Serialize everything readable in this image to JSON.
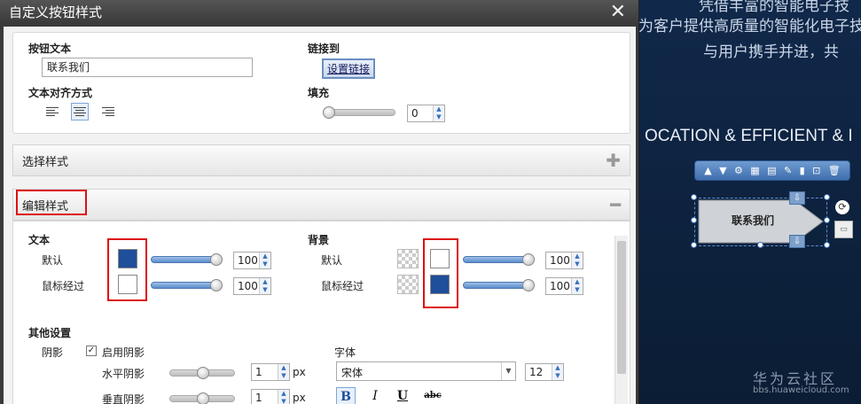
{
  "background": {
    "line1": "凭借丰富的智能电子技",
    "line2": "为客户提供高质量的智能化电子技",
    "line3": "与用户携手并进，共",
    "tagline": "OCATION & EFFICIENT & I",
    "widget_label": "联系我们",
    "watermark_title": "华为云社区",
    "watermark_url": "bbs.huaweicloud.com"
  },
  "dialog": {
    "title": "自定义按钮样式",
    "close_glyph": "✕",
    "button_text_label": "按钮文本",
    "button_text_value": "联系我们",
    "link_label": "链接到",
    "link_button": "设置链接",
    "align_label": "文本对齐方式",
    "fill_label": "填充",
    "fill_value": "0",
    "fill_level": 0,
    "sections": {
      "choose_style": "选择样式",
      "edit_style": "编辑样式"
    },
    "text": {
      "heading": "文本",
      "default_label": "默认",
      "hover_label": "鼠标经过",
      "default_color": "#1f4e9a",
      "hover_color": "#ffffff",
      "default_opacity": "100",
      "hover_opacity": "100"
    },
    "background": {
      "heading": "背景",
      "default_label": "默认",
      "hover_label": "鼠标经过",
      "default_color": "#ffffff",
      "hover_color": "#1f4e9a",
      "default_opacity": "100",
      "hover_opacity": "100"
    },
    "other": {
      "heading": "其他设置",
      "shadow_label": "阴影",
      "enable_shadow_label": "启用阴影",
      "h_shadow_label": "水平阴影",
      "v_shadow_label": "垂直阴影",
      "h_shadow_value": "1",
      "v_shadow_value": "1",
      "unit": "px",
      "font_label": "字体",
      "font_value": "宋体",
      "font_size": "12",
      "bold": "B",
      "italic": "I",
      "underline": "U",
      "strike": "abc"
    }
  },
  "colors": {
    "accent": "#1f4e9a",
    "highlight": "#dd1111"
  }
}
